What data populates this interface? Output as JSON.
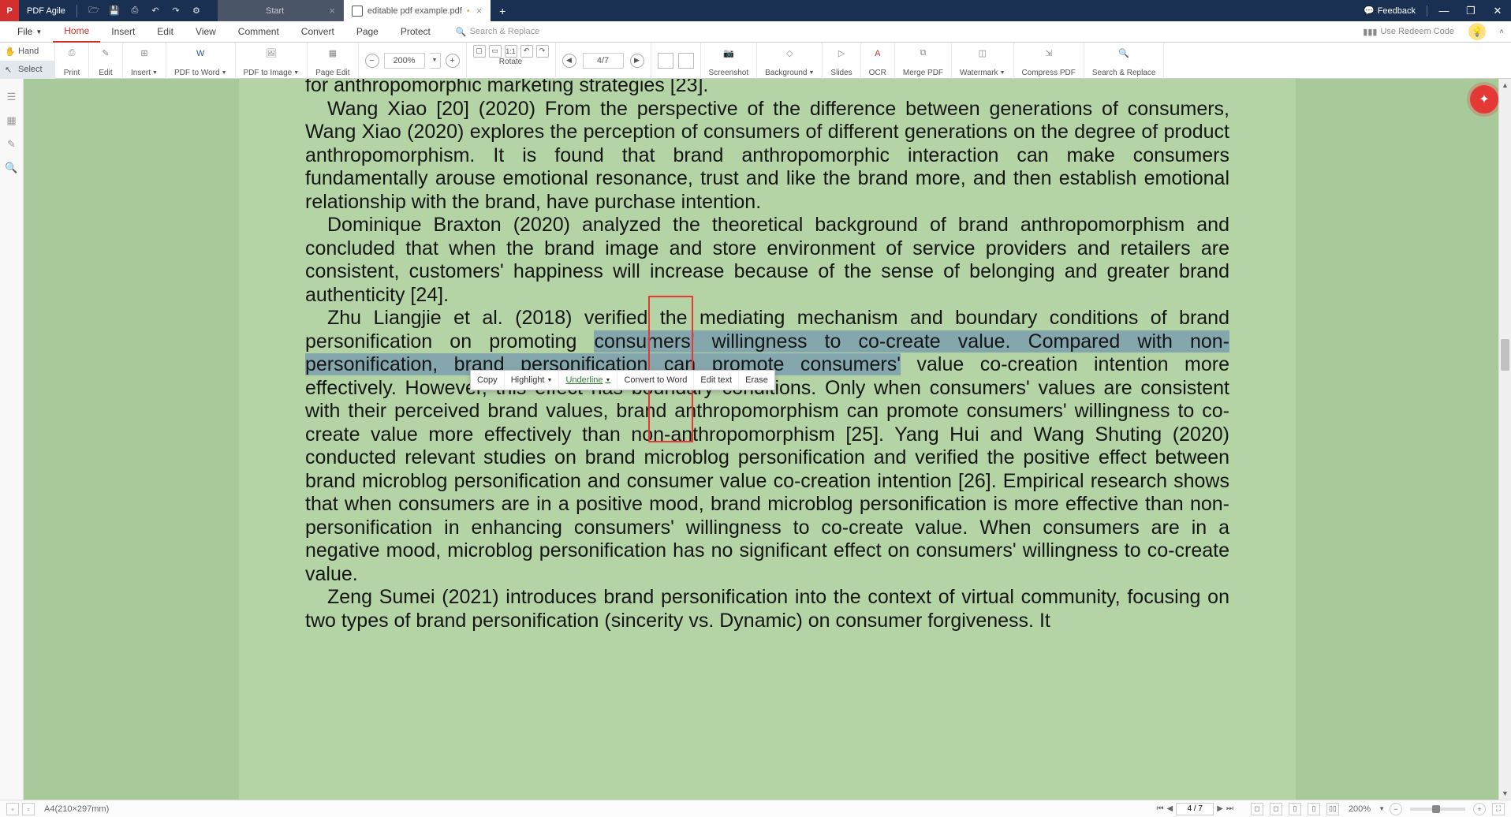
{
  "app": {
    "name": "PDF Agile"
  },
  "tabs": {
    "start": "Start",
    "active": "editable pdf example.pdf"
  },
  "titlebar": {
    "feedback": "Feedback"
  },
  "menu": {
    "file": "File",
    "home": "Home",
    "insert": "Insert",
    "edit": "Edit",
    "view": "View",
    "comment": "Comment",
    "convert": "Convert",
    "page": "Page",
    "protect": "Protect",
    "search_placeholder": "Search & Replace",
    "redeem": "Use Redeem Code"
  },
  "ribbon": {
    "hand": "Hand",
    "select": "Select",
    "print": "Print",
    "edit": "Edit",
    "insert": "Insert",
    "pdf_to_word": "PDF to Word",
    "pdf_to_image": "PDF to Image",
    "page_edit": "Page Edit",
    "rotate": "Rotate",
    "zoom_value": "200%",
    "page_value": "4/7",
    "screenshot": "Screenshot",
    "background": "Background",
    "slides": "Slides",
    "ocr": "OCR",
    "merge": "Merge PDF",
    "watermark": "Watermark",
    "compress": "Compress PDF",
    "search_replace": "Search & Replace"
  },
  "context_menu": {
    "copy": "Copy",
    "highlight": "Highlight",
    "underline": "Underline",
    "convert": "Convert to Word",
    "edit_text": "Edit text",
    "erase": "Erase"
  },
  "status": {
    "paper": "A4(210×297mm)",
    "page": "4 / 7",
    "zoom": "200%"
  },
  "doc": {
    "l1": "for anthropomorphic marketing strategies [23].",
    "l2": "Wang Xiao [20] (2020) From the perspective of the difference between generations of consumers, Wang Xiao (2020) explores the perception of consumers of different generations on the degree of product anthropomorphism. It is found that brand anthropomorphic interaction can make consumers fundamentally arouse emotional resonance, trust and like the brand more, and then establish emotional relationship with the brand, have purchase intention.",
    "l3": "Dominique Braxton (2020) analyzed the theoretical background of brand anthropomorphism and concluded that when the brand image and store environment of service providers and retailers are consistent, customers' happiness will increase because of the sense of belonging and greater brand authenticity [24].",
    "p4a": "Zhu Liangjie et al. (2018) verified the mediating mechanism and boundary conditions of brand personification on promoting ",
    "p4sel": "consumers' willingness to co-create value. Compared with non-personification, brand personification can promote consumers'",
    "p4b": " value co-creation intention more effectively. However, this effect has boundary conditions. Only when consumers' values are consistent with their perceived brand values, brand anthropomorphism can promote consumers' willingness to co-create value more effectively than non-anthropomorphism [25]. Yang Hui and Wang Shuting (2020) conducted relevant studies on brand microblog personification and verified the positive effect between brand microblog personification and consumer value co-creation intention [26]. Empirical research shows that when consumers are in a positive mood, brand microblog personification is more effective than non-personification in enhancing consumers' willingness to co-create value. When consumers are in a negative mood, microblog personification has no significant effect on consumers' willingness to co-create value.",
    "l5": "Zeng Sumei (2021) introduces brand personification into the context of virtual community, focusing on two types of brand personification (sincerity vs. Dynamic) on consumer forgiveness. It"
  }
}
